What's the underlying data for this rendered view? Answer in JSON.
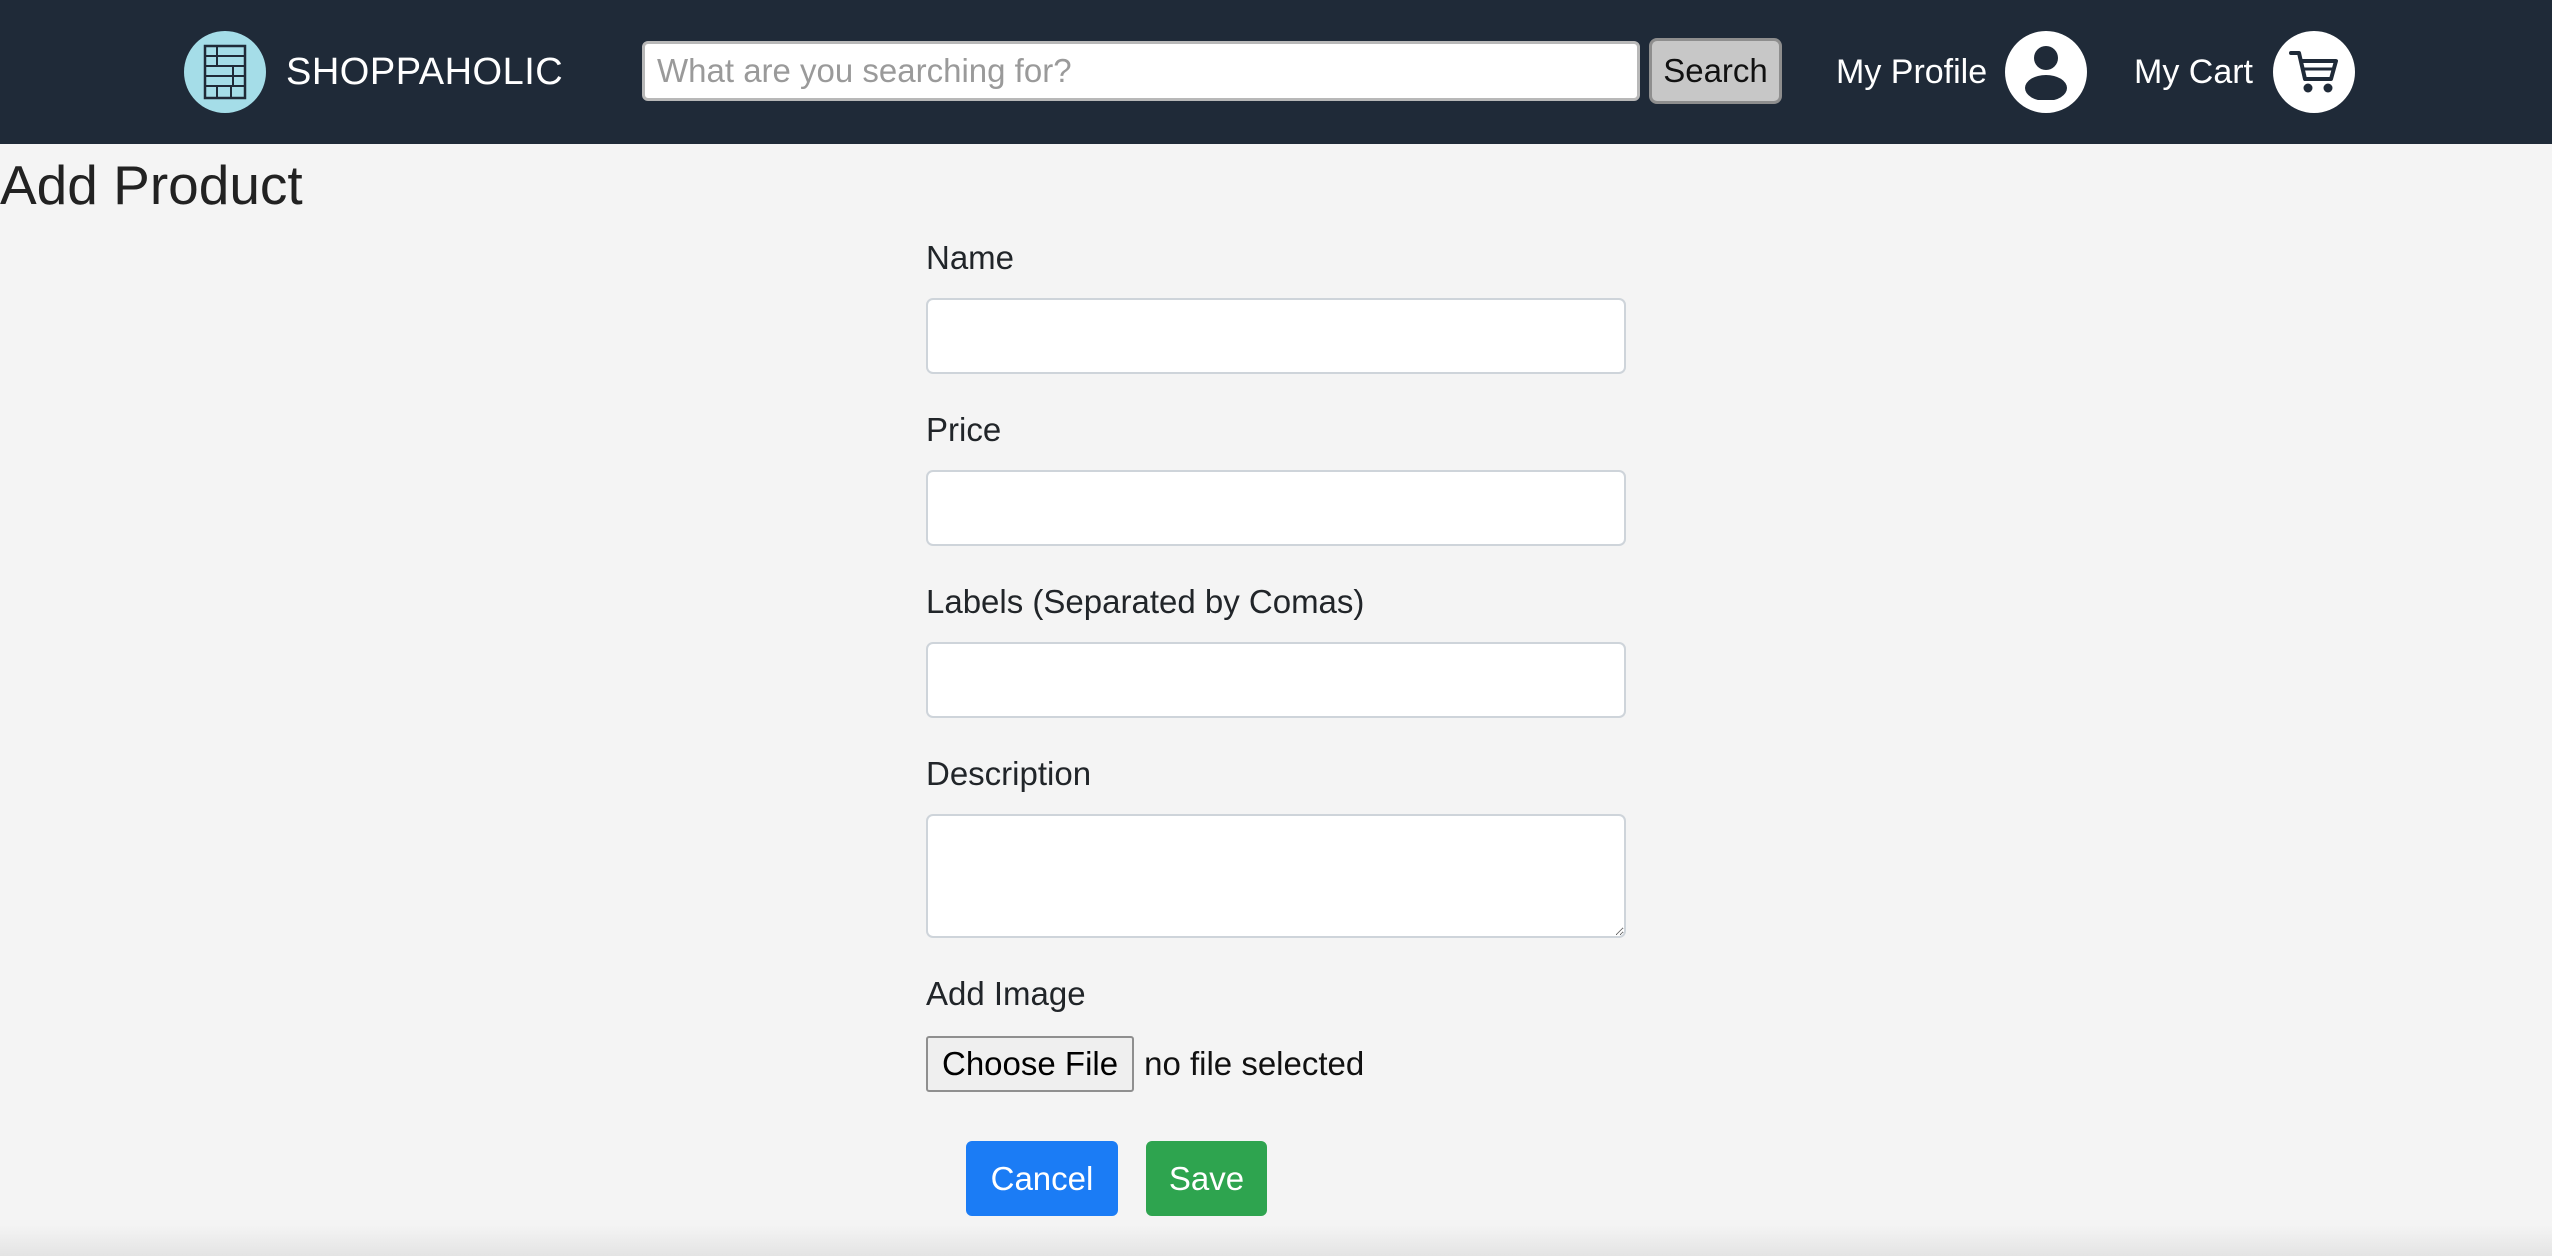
{
  "navbar": {
    "brand_name": "SHOPPAHOLIC",
    "brand_logo_icon": "store-logo-icon",
    "search_placeholder": "What are you searching for?",
    "search_value": "",
    "search_button_label": "Search",
    "profile_label": "My Profile",
    "profile_icon": "user-icon",
    "cart_label": "My Cart",
    "cart_icon": "shopping-cart-icon"
  },
  "page": {
    "title": "Add Product"
  },
  "form": {
    "name_label": "Name",
    "name_value": "",
    "price_label": "Price",
    "price_value": "",
    "labels_label": "Labels (Separated by Comas)",
    "labels_value": "",
    "description_label": "Description",
    "description_value": "",
    "image_label": "Add Image",
    "choose_file_label": "Choose File",
    "file_status": "no file selected",
    "cancel_label": "Cancel",
    "save_label": "Save"
  },
  "colors": {
    "navbar_bg": "#1f2a38",
    "page_bg": "#f4f4f4",
    "logo_bg": "#a5dde8",
    "cancel_button": "#1b7cf5",
    "save_button": "#2ea44f"
  }
}
